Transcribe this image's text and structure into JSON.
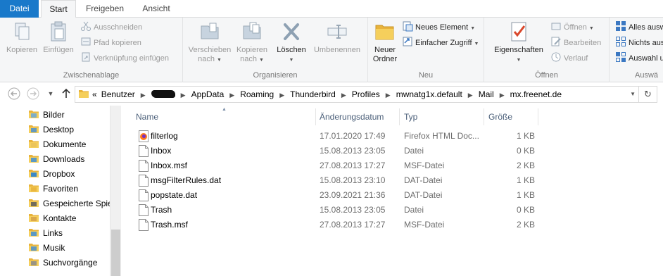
{
  "tabs": {
    "datei": "Datei",
    "start": "Start",
    "freigeben": "Freigeben",
    "ansicht": "Ansicht"
  },
  "ribbon": {
    "zwischenablage": {
      "label": "Zwischenablage",
      "kopieren": "Kopieren",
      "einfuegen": "Einfügen",
      "ausschneiden": "Ausschneiden",
      "pfad_kopieren": "Pfad kopieren",
      "verknuepfung_einfuegen": "Verknüpfung einfügen"
    },
    "organisieren": {
      "label": "Organisieren",
      "verschieben_1": "Verschieben",
      "verschieben_2": "nach",
      "kopieren_1": "Kopieren",
      "kopieren_2": "nach",
      "loeschen": "Löschen",
      "umbenennen": "Umbenennen"
    },
    "neu": {
      "label": "Neu",
      "neuer_ordner_1": "Neuer",
      "neuer_ordner_2": "Ordner",
      "neues_element": "Neues Element",
      "einfacher_zugriff": "Einfacher Zugriff"
    },
    "oeffnen": {
      "label": "Öffnen",
      "eigenschaften": "Eigenschaften",
      "oeffnen": "Öffnen",
      "bearbeiten": "Bearbeiten",
      "verlauf": "Verlauf"
    },
    "auswaehlen": {
      "label": "Auswä",
      "alles_auswaehlen": "Alles ausw",
      "nichts_auswaehlen": "Nichts aus",
      "auswahl_umkehren": "Auswahl u"
    }
  },
  "address": {
    "overflow": "«",
    "crumbs": [
      "Benutzer",
      "AppData",
      "Roaming",
      "Thunderbird",
      "Profiles",
      "mwnatg1x.default",
      "Mail",
      "mx.freenet.de"
    ]
  },
  "navpane": {
    "items": [
      {
        "label": "Bilder",
        "icon": "pictures-folder-icon"
      },
      {
        "label": "Desktop",
        "icon": "desktop-folder-icon"
      },
      {
        "label": "Dokumente",
        "icon": "documents-folder-icon"
      },
      {
        "label": "Downloads",
        "icon": "downloads-folder-icon"
      },
      {
        "label": "Dropbox",
        "icon": "dropbox-icon"
      },
      {
        "label": "Favoriten",
        "icon": "favorites-folder-icon"
      },
      {
        "label": "Gespeicherte Spiel",
        "icon": "saved-games-folder-icon"
      },
      {
        "label": "Kontakte",
        "icon": "contacts-folder-icon"
      },
      {
        "label": "Links",
        "icon": "links-folder-icon"
      },
      {
        "label": "Musik",
        "icon": "music-folder-icon"
      },
      {
        "label": "Suchvorgänge",
        "icon": "searches-folder-icon"
      }
    ]
  },
  "filelist": {
    "columns": {
      "name": "Name",
      "date": "Änderungsdatum",
      "type": "Typ",
      "size": "Größe"
    },
    "files": [
      {
        "name": "filterlog",
        "date": "17.01.2020 17:49",
        "type": "Firefox HTML Doc...",
        "size": "1 KB",
        "icon": "firefox-html-file-icon"
      },
      {
        "name": "Inbox",
        "date": "15.08.2013 23:05",
        "type": "Datei",
        "size": "0 KB",
        "icon": "file-icon"
      },
      {
        "name": "Inbox.msf",
        "date": "27.08.2013 17:27",
        "type": "MSF-Datei",
        "size": "2 KB",
        "icon": "file-icon"
      },
      {
        "name": "msgFilterRules.dat",
        "date": "15.08.2013 23:10",
        "type": "DAT-Datei",
        "size": "1 KB",
        "icon": "file-icon"
      },
      {
        "name": "popstate.dat",
        "date": "23.09.2021 21:36",
        "type": "DAT-Datei",
        "size": "1 KB",
        "icon": "file-icon"
      },
      {
        "name": "Trash",
        "date": "15.08.2013 23:05",
        "type": "Datei",
        "size": "0 KB",
        "icon": "file-icon"
      },
      {
        "name": "Trash.msf",
        "date": "27.08.2013 17:27",
        "type": "MSF-Datei",
        "size": "2 KB",
        "icon": "file-icon"
      }
    ]
  }
}
